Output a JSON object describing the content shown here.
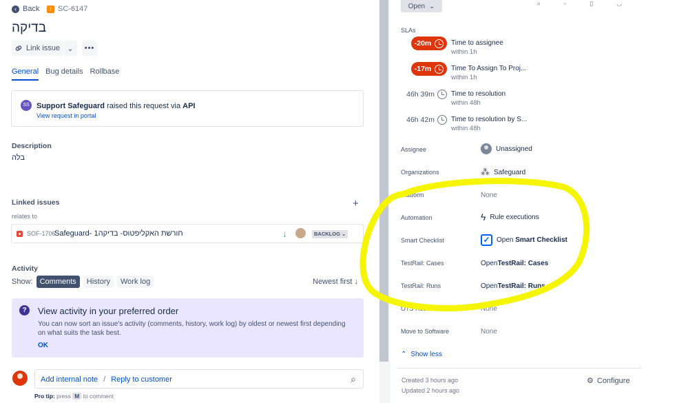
{
  "header": {
    "back_label": "Back",
    "issue_key": "SC-6147",
    "title": "בדיקה"
  },
  "actions": {
    "link_issue": "Link issue",
    "more": "•••"
  },
  "tabs": [
    {
      "label": "General",
      "active": true
    },
    {
      "label": "Bug details"
    },
    {
      "label": "Rollbase"
    }
  ],
  "request": {
    "avatar_initials": "SS",
    "requester": "Support Safeguard",
    "middle": " raised this request via ",
    "channel": "API",
    "view_link": "View request in portal"
  },
  "description": {
    "heading": "Description",
    "body": "בלה"
  },
  "linked": {
    "heading": "Linked issues",
    "relation": "relates to",
    "items": [
      {
        "key": "SOF-1706",
        "summary": "Safeguard- חורשת האקליפטוס- בדיקה1",
        "status": "BACKLOG"
      }
    ]
  },
  "activity": {
    "heading": "Activity",
    "show_label": "Show:",
    "filters": [
      "Comments",
      "History",
      "Work log"
    ],
    "sort": "Newest first",
    "panel_title": "View activity in your preferred order",
    "panel_body": "You can now sort an issue's activity (comments, history, work log) by oldest or newest first depending on what suits the task best.",
    "panel_ok": "OK"
  },
  "comment": {
    "add_internal": "Add internal note",
    "separator": "/",
    "reply": "Reply to customer",
    "protip_prefix": "Pro tip:",
    "protip_press": " press ",
    "protip_key": "M",
    "protip_suffix": " to comment"
  },
  "sidebar": {
    "status": "Open",
    "slas_label": "SLAs",
    "slas": [
      {
        "time": "-20m",
        "breached": true,
        "name": "Time to assignee",
        "goal": "within 1h"
      },
      {
        "time": "-17m",
        "breached": true,
        "name": "Time To Assign To Proj...",
        "goal": "within 1h"
      },
      {
        "time": "46h 39m",
        "breached": false,
        "name": "Time to resolution",
        "goal": "within 48h"
      },
      {
        "time": "46h 42m",
        "breached": false,
        "name": "Time to resolution by S...",
        "goal": "within 48h"
      }
    ],
    "fields": {
      "assignee": {
        "label": "Assignee",
        "value": "Unassigned"
      },
      "organizations": {
        "label": "Organizations",
        "value": "Safeguard"
      },
      "platform": {
        "label": "Platform",
        "value": "None"
      },
      "automation": {
        "label": "Automation",
        "value": "Rule executions"
      },
      "smart_checklist": {
        "label": "Smart Checklist",
        "open": "Open ",
        "value": "Smart Checklist"
      },
      "testrail_cases": {
        "label": "TestRail: Cases",
        "open": "Open ",
        "value": "TestRail: Cases"
      },
      "testrail_runs": {
        "label": "TestRail: Runs",
        "open": "Open ",
        "value": "TestRail: Runs"
      },
      "ots_resolution": {
        "label": "OTS Resolution",
        "value": "None"
      },
      "move_to_software": {
        "label": "Move to Software",
        "value": "None"
      }
    },
    "show_less": "Show less",
    "created": "Created 3 hours ago",
    "updated": "Updated 2 hours ago",
    "configure": "Configure"
  },
  "colors": {
    "accent": "#0052cc",
    "sla_breached": "#de350b",
    "annotation": "#f6f500"
  },
  "icons": [
    "back-arrow-icon",
    "link-icon",
    "chevron-down-icon",
    "bug-icon",
    "priority-low-icon",
    "question-icon",
    "paperclip-icon",
    "clock-icon",
    "user-icon",
    "organization-icon",
    "bolt-icon",
    "checklist-icon",
    "gear-icon"
  ]
}
